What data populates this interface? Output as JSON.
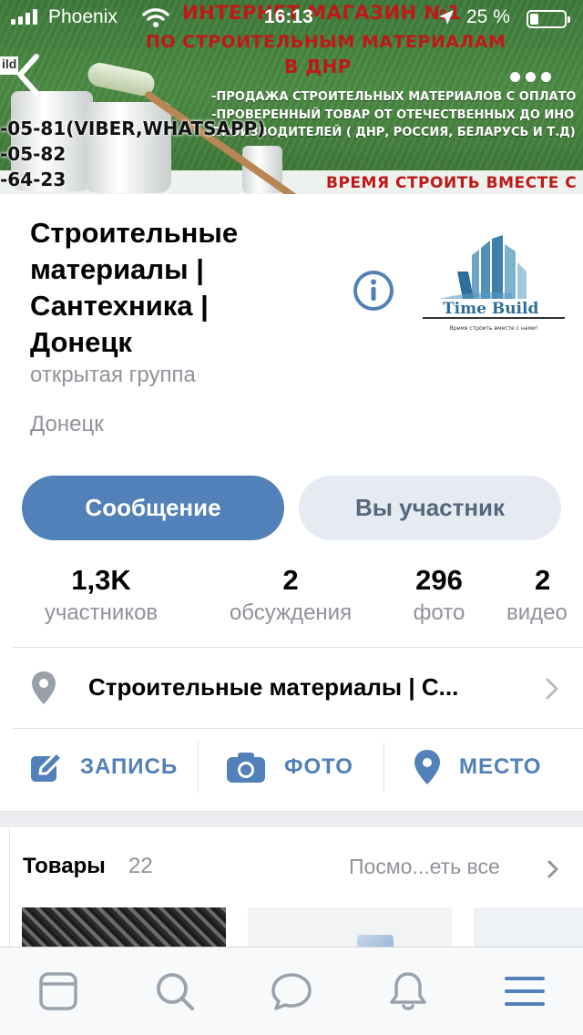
{
  "status_bar": {
    "carrier": "Phoenix",
    "time": "16:13",
    "battery_text": "25 %",
    "battery_level": 0.25
  },
  "cover": {
    "headline_1": "ИНТЕРНЕТ МАГАЗИН №1",
    "headline_2": "ПО СТРОИТЕЛЬНЫМ МАТЕРИАЛАМ",
    "headline_3": "В ДНР",
    "bullet_1": "-ПРОДАЖА СТРОИТЕЛЬНЫХ МАТЕРИАЛОВ С ОПЛАТО",
    "bullet_2": "-ПРОВЕРЕННЫЙ ТОВАР ОТ ОТЕЧЕСТВЕННЫХ ДО ИНО",
    "bullet_3": "ПРОИЗВОДИТЕЛЕЙ ( ДНР, РОССИЯ, БЕЛАРУСЬ И Т.Д)",
    "phone_1": "-05-81(VIBER,WHATSAPP)",
    "phone_2": "-05-82",
    "phone_3": "-64-23",
    "slogan": "ВРЕМЯ СТРОИТЬ ВМЕСТЕ С",
    "logo_fragment": "ild"
  },
  "group": {
    "title": "Строительные материалы | Сантехника | Донецк",
    "type": "открытая группа",
    "city": "Донецк",
    "logo_name": "Time Build",
    "logo_tagline": "Время строить вместе с нами!"
  },
  "actions": {
    "message": "Сообщение",
    "member": "Вы участник"
  },
  "counters": [
    {
      "value": "1,3K",
      "label": "участников"
    },
    {
      "value": "2",
      "label": "обсуждения"
    },
    {
      "value": "296",
      "label": "фото"
    },
    {
      "value": "2",
      "label": "видео"
    }
  ],
  "address": {
    "text": "Строительные материалы | С..."
  },
  "quick_actions": {
    "post": "ЗАПИСЬ",
    "photo": "ФОТО",
    "place": "МЕСТО"
  },
  "goods": {
    "title": "Товары",
    "count": "22",
    "view_all": "Посмо...еть все"
  },
  "colors": {
    "accent": "#5181b8",
    "secondary_button": "#e5ebf1",
    "muted_text": "#8f939a",
    "banner_red": "#c01818",
    "banner_green": "#4d8b45"
  },
  "icons": {
    "tab_1": "news-feed-icon",
    "tab_2": "search-icon",
    "tab_3": "messages-icon",
    "tab_4": "notifications-bell-icon",
    "tab_5": "menu-icon"
  }
}
